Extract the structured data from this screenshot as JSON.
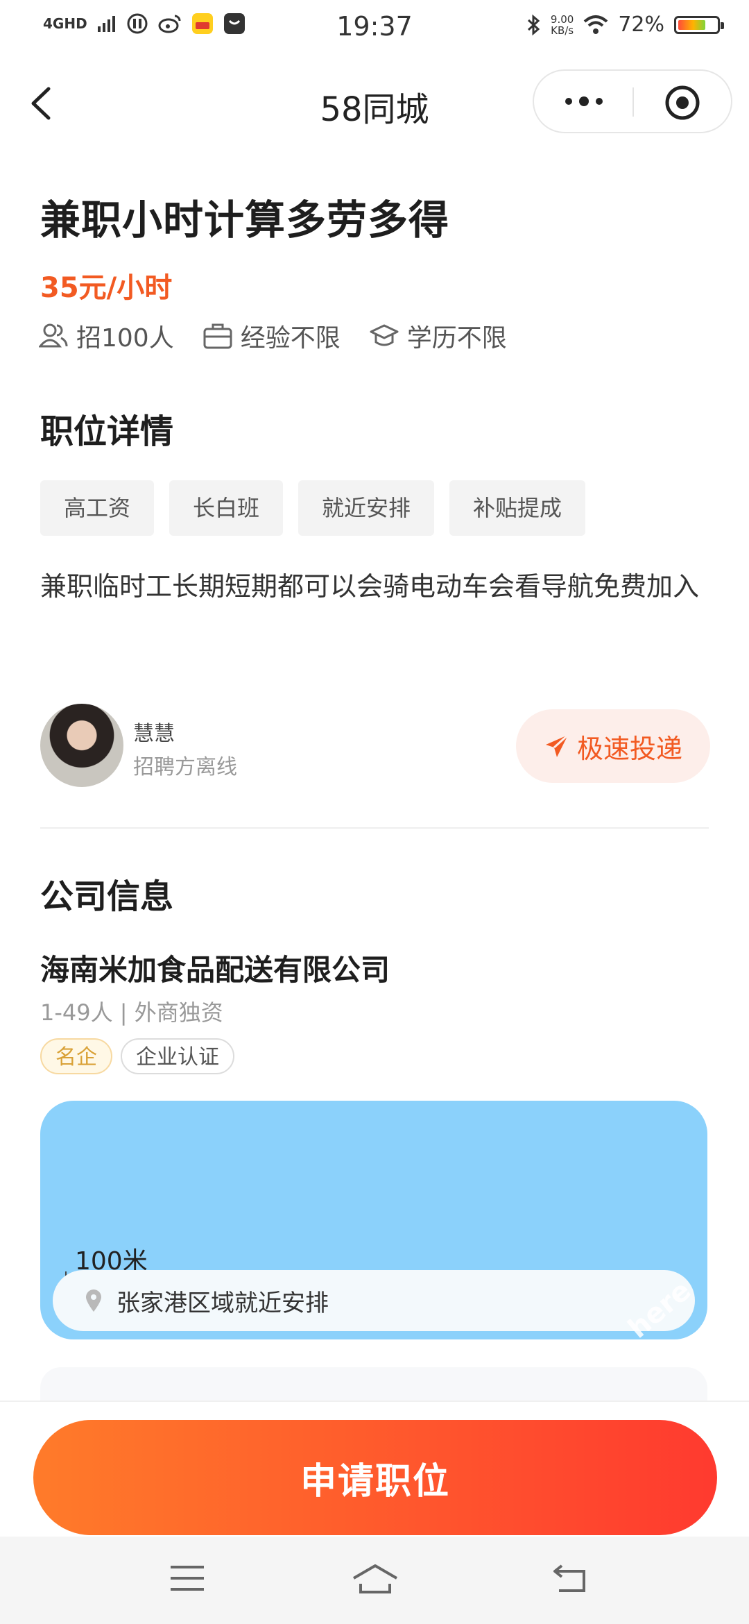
{
  "status_bar": {
    "network": "4GHD",
    "time": "19:37",
    "speed_value": "9.00",
    "speed_unit": "KB/s",
    "battery_percent": "72%",
    "battery_level": 0.72,
    "icons": [
      "signal-icon",
      "vpn-icon",
      "weibo-icon",
      "tmall-app-icon",
      "bag-app-icon",
      "bluetooth-icon",
      "wifi-icon",
      "battery-icon"
    ]
  },
  "nav": {
    "title": "58同城",
    "back_icon": "chevron-left-icon",
    "more_icon": "more-dots-icon",
    "close_icon": "target-circle-icon"
  },
  "job": {
    "title": "兼职小时计算多劳多得",
    "salary": "35元/小时",
    "meta": [
      {
        "icon": "people-icon",
        "label": "招100人"
      },
      {
        "icon": "briefcase-icon",
        "label": "经验不限"
      },
      {
        "icon": "graduation-cap-icon",
        "label": "学历不限"
      }
    ]
  },
  "details": {
    "heading": "职位详情",
    "tags": [
      "高工资",
      "长白班",
      "就近安排",
      "补贴提成"
    ],
    "description": "兼职临时工长期短期都可以会骑电动车会看导航免费加入"
  },
  "recruiter": {
    "name": "慧慧",
    "status": "招聘方离线",
    "fast_apply_label": "极速投递"
  },
  "company": {
    "heading": "公司信息",
    "name": "海南米加食品配送有限公司",
    "info": "1-49人 | 外商独资",
    "badges": [
      "名企",
      "企业认证"
    ]
  },
  "map": {
    "scale_label": "100米",
    "address": "张家港区域就近安排",
    "watermark": "here"
  },
  "apply": {
    "label": "申请职位"
  },
  "system_nav": {
    "icons": [
      "menu-icon",
      "home-icon",
      "back-icon"
    ]
  },
  "colors": {
    "accent": "#f25a22",
    "apply_gradient_start": "#ff7b2a",
    "apply_gradient_end": "#ff3a2f",
    "map_water": "#8bd1fb"
  }
}
